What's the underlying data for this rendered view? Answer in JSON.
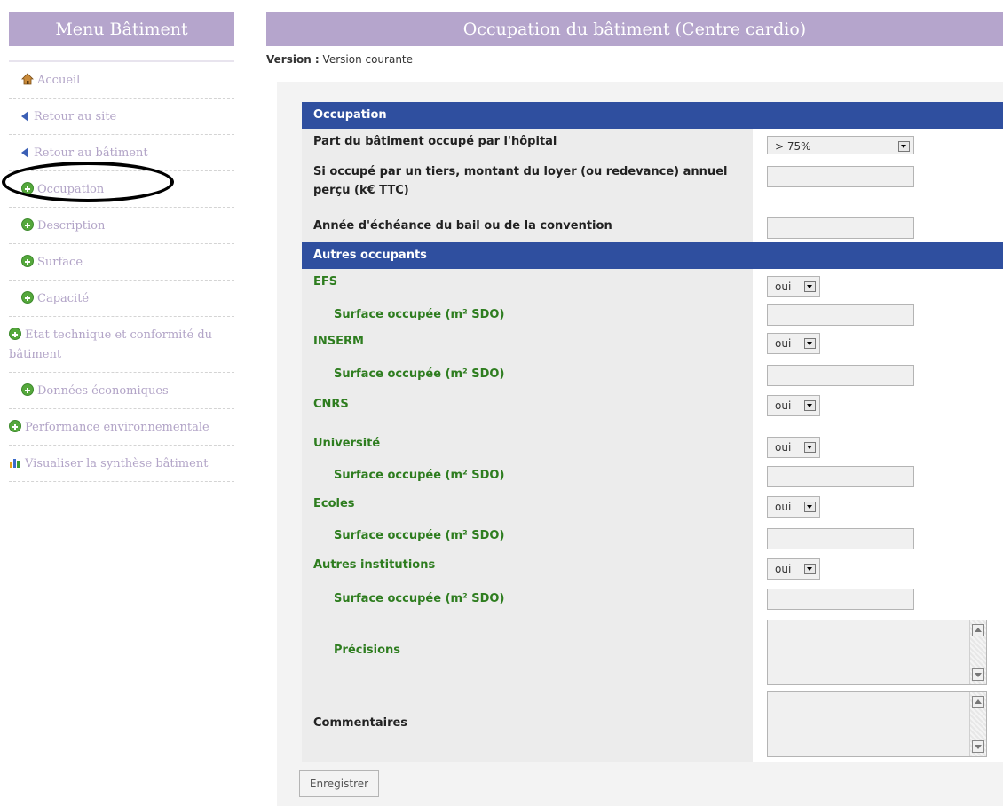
{
  "sidebar": {
    "title": "Menu Bâtiment",
    "items": [
      {
        "label": "Accueil",
        "icon": "home-icon"
      },
      {
        "label": "Retour au site",
        "icon": "back-arrow-icon"
      },
      {
        "label": "Retour au bâtiment",
        "icon": "back-arrow-icon"
      },
      {
        "label": "Occupation",
        "icon": "plus-circle-icon"
      },
      {
        "label": "Description",
        "icon": "plus-circle-icon"
      },
      {
        "label": "Surface",
        "icon": "plus-circle-icon"
      },
      {
        "label": "Capacité",
        "icon": "plus-circle-icon"
      },
      {
        "label": "Etat technique et conformité du bâtiment",
        "icon": "plus-circle-icon"
      },
      {
        "label": "Données économiques",
        "icon": "plus-circle-icon"
      },
      {
        "label": "Performance environnementale",
        "icon": "plus-circle-icon"
      },
      {
        "label": "Visualiser la synthèse bâtiment",
        "icon": "bar-chart-icon"
      }
    ]
  },
  "header": {
    "title": "Occupation du bâtiment (Centre cardio)"
  },
  "version": {
    "label": "Version :",
    "value": "Version courante"
  },
  "sections": {
    "occupation": "Occupation",
    "autres": "Autres occupants"
  },
  "fields": {
    "part": {
      "label": "Part du bâtiment occupé par l'hôpital",
      "value": "> 75%"
    },
    "loyer": {
      "label": "Si occupé par un tiers, montant du loyer (ou redevance) annuel perçu (k€ TTC)",
      "value": ""
    },
    "echeance": {
      "label": "Année d'échéance du bail ou de la convention",
      "value": ""
    },
    "efs": {
      "label": "EFS",
      "value": "oui"
    },
    "efs_surface": {
      "label": "Surface occupée (m² SDO)",
      "value": ""
    },
    "inserm": {
      "label": "INSERM",
      "value": "oui"
    },
    "inserm_surface": {
      "label": "Surface occupée (m² SDO)",
      "value": ""
    },
    "cnrs": {
      "label": "CNRS",
      "value": "oui"
    },
    "universite": {
      "label": "Université",
      "value": "oui"
    },
    "universite_surface": {
      "label": "Surface occupée (m² SDO)",
      "value": ""
    },
    "ecoles": {
      "label": "Ecoles",
      "value": "oui"
    },
    "ecoles_surface": {
      "label": "Surface occupée (m² SDO)",
      "value": ""
    },
    "autres_inst": {
      "label": "Autres institutions",
      "value": "oui"
    },
    "autres_surface": {
      "label": "Surface occupée (m² SDO)",
      "value": ""
    },
    "precisions": {
      "label": "Précisions",
      "value": ""
    },
    "commentaires": {
      "label": "Commentaires",
      "value": ""
    }
  },
  "save_button": "Enregistrer",
  "colors": {
    "header_bg": "#b5a5cc",
    "section_bg": "#2f4f9f",
    "green_label": "#2e7d1f",
    "sidebar_text": "#b2a4c7"
  }
}
